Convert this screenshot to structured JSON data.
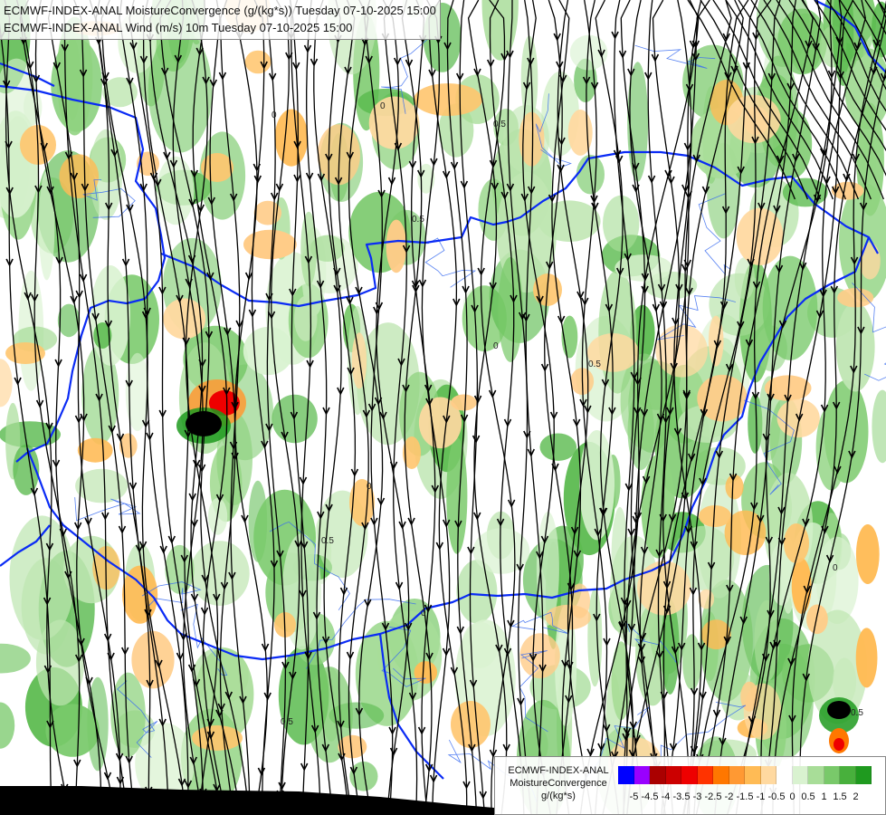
{
  "title": {
    "line1": "ECMWF-INDEX-ANAL MoistureConvergence (g/(kg*s)) Tuesday 07-10-2025 15:00",
    "line2": "ECMWF-INDEX-ANAL Wind (m/s) 10m Tuesday 07-10-2025 15:00"
  },
  "legend": {
    "model": "ECMWF-INDEX-ANAL",
    "parameter": "MoistureConvergence",
    "unit": "g/(kg*s)",
    "colors": [
      "#0000ff",
      "#9900ff",
      "#aa0000",
      "#cc0000",
      "#ee0000",
      "#ff3300",
      "#ff7700",
      "#ff9933",
      "#ffbb55",
      "#ffd9a0",
      "#ffffff",
      "#d9f2d0",
      "#a8dd98",
      "#79c96a",
      "#48b03c",
      "#1f9a1f"
    ],
    "ticks": [
      "-5",
      "-4.5",
      "-4",
      "-3.5",
      "-3",
      "-2.5",
      "-2",
      "-1.5",
      "-1",
      "-0.5",
      "0",
      "0.5",
      "1",
      "1.5",
      "2"
    ]
  },
  "map": {
    "contour_labels": [
      "0",
      "0.5",
      "0",
      "0.5",
      "0",
      "0.5",
      "0",
      "0.5",
      "0",
      "0.5",
      "0",
      "0.5"
    ]
  }
}
